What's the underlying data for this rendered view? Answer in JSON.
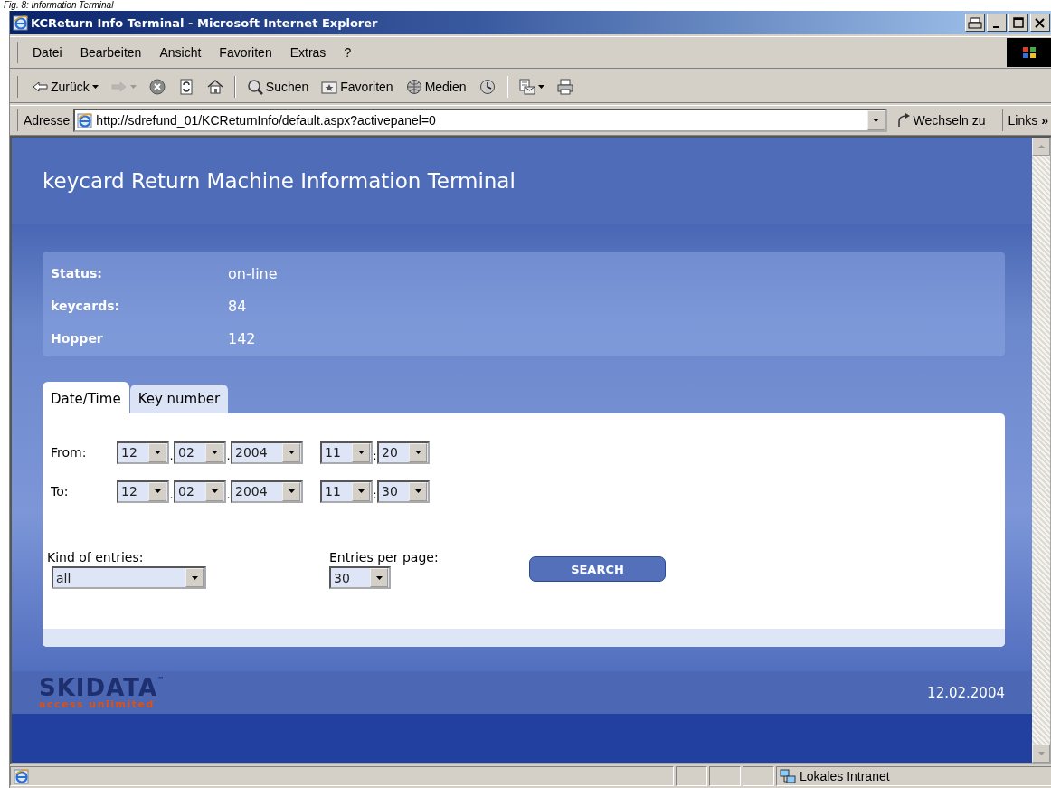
{
  "caption": "Fig. 8: Information Terminal",
  "window": {
    "title": "KCReturn Info Terminal - Microsoft Internet Explorer"
  },
  "menu": [
    "Datei",
    "Bearbeiten",
    "Ansicht",
    "Favoriten",
    "Extras",
    "?"
  ],
  "toolbar": [
    {
      "kind": "back",
      "label": "Zurück",
      "dropdown": true,
      "disabled": false
    },
    {
      "kind": "forward",
      "dropdown": true,
      "disabled": true
    },
    {
      "kind": "stop",
      "disabled": false
    },
    {
      "kind": "refresh",
      "disabled": false
    },
    {
      "kind": "home",
      "disabled": false
    },
    {
      "kind": "separator"
    },
    {
      "kind": "search",
      "label": "Suchen",
      "disabled": false
    },
    {
      "kind": "favorites",
      "label": "Favoriten",
      "disabled": false
    },
    {
      "kind": "media",
      "label": "Medien",
      "disabled": false
    },
    {
      "kind": "history",
      "disabled": false
    },
    {
      "kind": "separator"
    },
    {
      "kind": "mail",
      "dropdown": true,
      "disabled": false
    },
    {
      "kind": "print",
      "disabled": false
    }
  ],
  "address": {
    "label": "Adresse",
    "url": "http://sdrefund_01/KCReturnInfo/default.aspx?activepanel=0",
    "go": "Wechseln zu",
    "links": "Links",
    "more": "»"
  },
  "page": {
    "title": "keycard Return Machine Information Terminal",
    "status": [
      {
        "label": "Status:",
        "value": "on-line"
      },
      {
        "label": "keycards:",
        "value": "84"
      },
      {
        "label": "Hopper",
        "value": "142"
      }
    ],
    "tabs": [
      {
        "label": "Date/Time",
        "selected": true
      },
      {
        "label": "Key number",
        "selected": false
      }
    ],
    "ranges": [
      {
        "label": "From:",
        "date": [
          "12",
          "02",
          "2004"
        ],
        "time": [
          "11",
          "20"
        ]
      },
      {
        "label": "To:",
        "date": [
          "12",
          "02",
          "2004"
        ],
        "time": [
          "11",
          "30"
        ]
      }
    ],
    "date_sep": ".",
    "time_sep": ":",
    "kind_of_entries": {
      "label": "Kind of entries:",
      "value": "all"
    },
    "entries_per_page": {
      "label": "Entries per page:",
      "value": "30"
    },
    "search_button": "SEARCH",
    "footer": {
      "logo": "SKIDATA",
      "trademark": "™",
      "tagline": "access unlimited",
      "date": "12.02.2004"
    }
  },
  "status_bar": {
    "zone": "Lokales Intranet"
  }
}
